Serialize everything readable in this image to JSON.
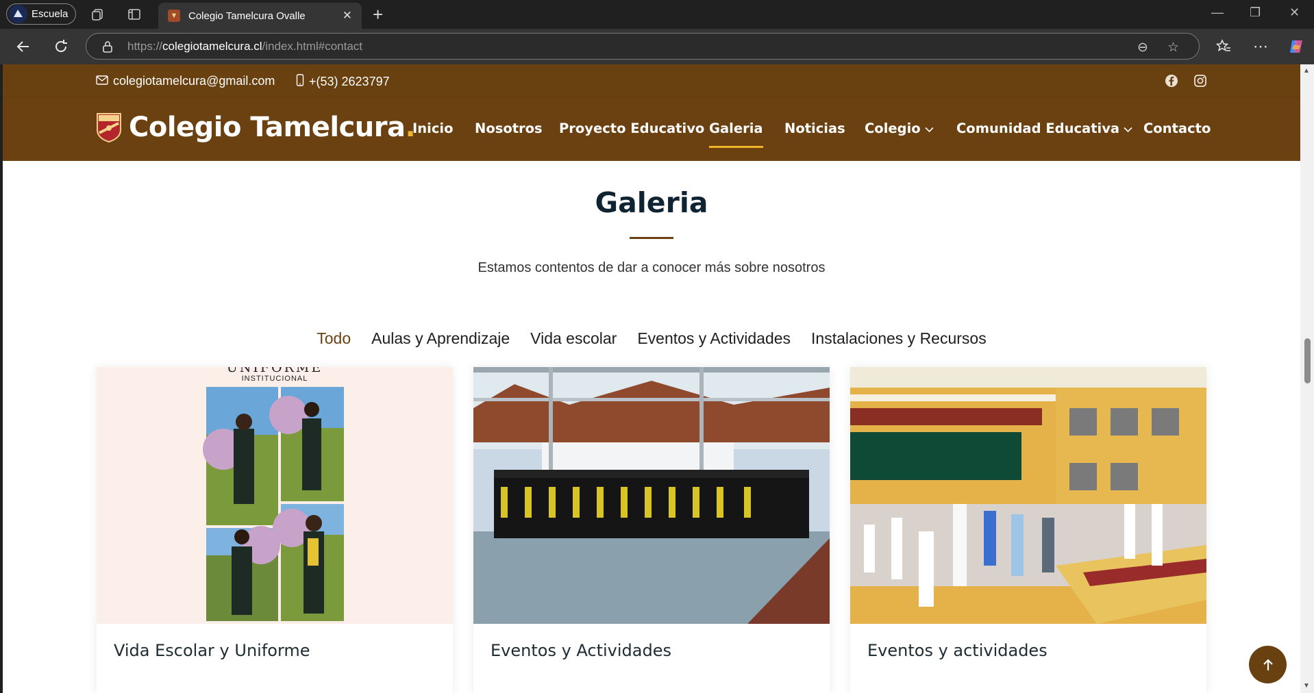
{
  "browser": {
    "profile_label": "Escuela",
    "tab_title": "Colegio Tamelcura Ovalle",
    "url_prefix": "https://",
    "url_domain": "colegiotamelcura.cl",
    "url_path": "/index.html#contact"
  },
  "topbar": {
    "email": "colegiotamelcura@gmail.com",
    "phone": "+(53) 2623797"
  },
  "header": {
    "logo_text": "Colegio Tamelcura",
    "logo_dot": ".",
    "menu": [
      {
        "label": "Inicio"
      },
      {
        "label": "Nosotros"
      },
      {
        "label": "Proyecto Educativo"
      },
      {
        "label": "Galeria"
      },
      {
        "label": "Noticias"
      },
      {
        "label": "Colegio"
      },
      {
        "label": "Comunidad Educativa"
      },
      {
        "label": "Contacto"
      }
    ]
  },
  "gallery": {
    "title": "Galeria",
    "subtitle": "Estamos contentos de dar a conocer más sobre nosotros",
    "filters": [
      {
        "label": "Todo"
      },
      {
        "label": "Aulas y Aprendizaje"
      },
      {
        "label": "Vida escolar"
      },
      {
        "label": "Eventos y Actividades"
      },
      {
        "label": "Instalaciones y Recursos"
      }
    ],
    "cards": [
      {
        "caption": "Vida Escolar y Uniforme",
        "poster_title": "UNIFORME",
        "poster_sub": "INSTITUCIONAL"
      },
      {
        "caption": "Eventos y Actividades"
      },
      {
        "caption": "Eventos y actividades"
      }
    ]
  },
  "colors": {
    "brand_brown": "#6b4111",
    "accent_gold": "#f0b429",
    "title_navy": "#0f2433"
  }
}
